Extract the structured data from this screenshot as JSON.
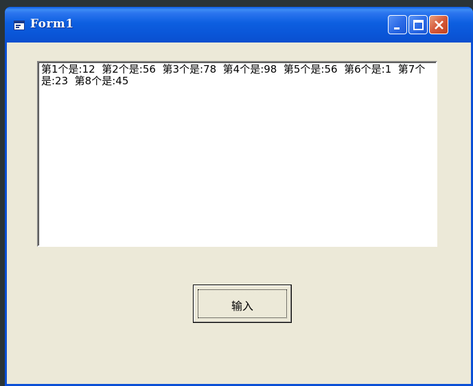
{
  "window": {
    "title": "Form1",
    "icon": "vb-form-icon"
  },
  "titlebar_buttons": {
    "minimize_icon": "minimize-icon",
    "maximize_icon": "maximize-icon",
    "close_icon": "close-icon",
    "close_color": "#d5593a"
  },
  "textbox": {
    "text": "第1个是:12  第2个是:56  第3个是:78  第4个是:98  第5个是:56  第6个是:1  第7个是:23  第8个是:45"
  },
  "buttons": {
    "input_label": "输入"
  },
  "colors": {
    "titlebar": "#0a56d8",
    "client_bg": "#ece9d8",
    "textbox_bg": "#ffffff"
  }
}
